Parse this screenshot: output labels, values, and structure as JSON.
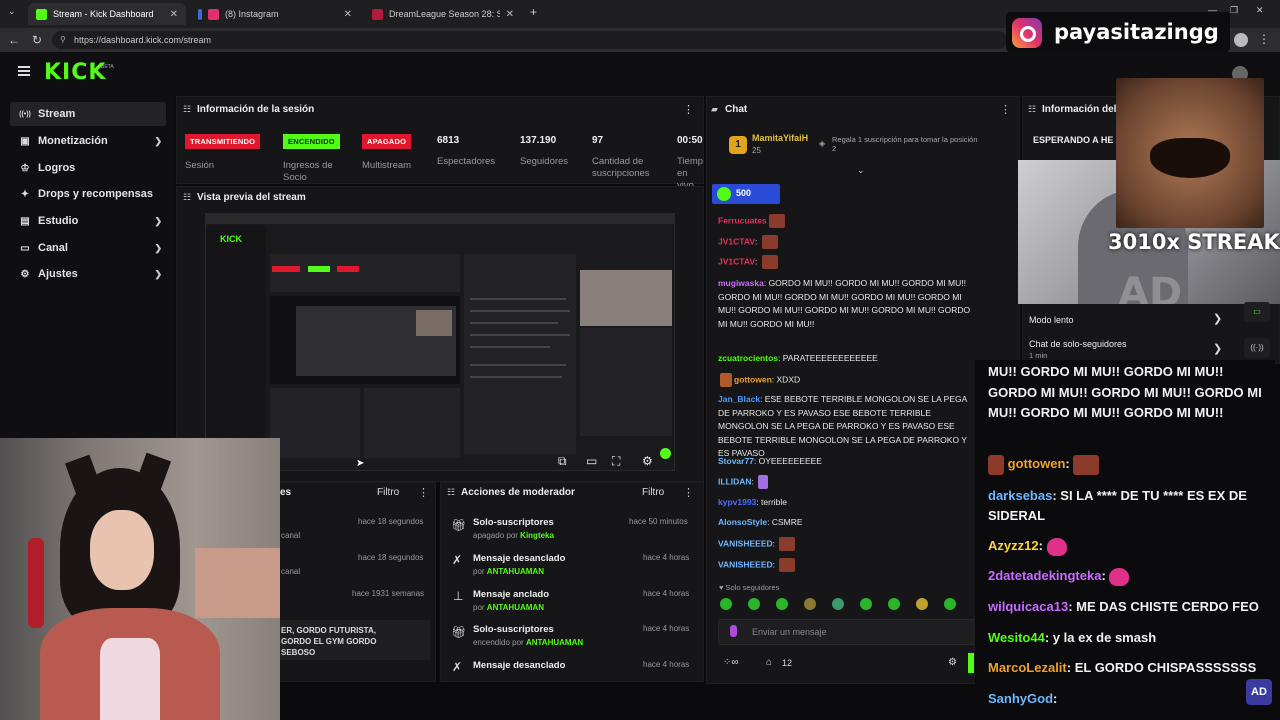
{
  "browser": {
    "tabs": [
      {
        "label": "Stream - Kick Dashboard",
        "active": true
      },
      {
        "label": "(8) Instagram",
        "active": false
      },
      {
        "label": "DreamLeague Season 28: South A",
        "active": false
      }
    ],
    "url": "https://dashboard.kick.com/stream",
    "new_tab": "+"
  },
  "instagram_overlay": {
    "handle": "payasitazingg"
  },
  "meme_overlay": {
    "text": "3010x STREAK"
  },
  "kick": {
    "logo": "KICK",
    "beta": "BETA"
  },
  "sidebar": {
    "items": [
      {
        "label": "Stream",
        "icon": "stream-icon",
        "glyph": "((•))",
        "active": true,
        "chevron": false
      },
      {
        "label": "Monetización",
        "icon": "money-icon",
        "glyph": "▣",
        "active": false,
        "chevron": true
      },
      {
        "label": "Logros",
        "icon": "trophy-icon",
        "glyph": "🏆",
        "active": false,
        "chevron": false
      },
      {
        "label": "Drops y recompensas",
        "icon": "gift-icon",
        "glyph": "✦",
        "active": false,
        "chevron": false
      },
      {
        "label": "Estudio",
        "icon": "studio-icon",
        "glyph": "▤",
        "active": false,
        "chevron": true
      },
      {
        "label": "Canal",
        "icon": "channel-icon",
        "glyph": "▭",
        "active": false,
        "chevron": true
      },
      {
        "label": "Ajustes",
        "icon": "settings-icon",
        "glyph": "⚙",
        "active": false,
        "chevron": true
      }
    ]
  },
  "session": {
    "title": "Información de la sesión",
    "badges": [
      {
        "label": "TRANSMITIENDO",
        "color": "#e0182d"
      },
      {
        "label": "ENCENDIDO",
        "color": "#53fc18"
      },
      {
        "label": "APAGADO",
        "color": "#e0182d"
      }
    ],
    "badge_labels": [
      "Sesión",
      "Ingresos de Socio",
      "Multistream"
    ],
    "stats": [
      {
        "value": "6813",
        "label": "Espectadores"
      },
      {
        "value": "137.190",
        "label": "Seguidores"
      },
      {
        "value": "97",
        "label": "Cantidad de suscripciones"
      },
      {
        "value": "00:50",
        "label": "Tiempo en vivo"
      }
    ]
  },
  "preview": {
    "title": "Vista previa del stream"
  },
  "activity": {
    "title": "es",
    "filter": "Filtro",
    "rows": [
      {
        "time": "hace 18 segundos",
        "sub": "canal"
      },
      {
        "time": "hace 18 segundos",
        "sub": "canal"
      },
      {
        "time": "hace 1931 semanas",
        "sub": "ER, GORDO FUTURISTA, GORDO EL GYM GORDO SEBOSO"
      }
    ]
  },
  "mod_actions": {
    "title": "Acciones de moderador",
    "filter": "Filtro",
    "rows": [
      {
        "title": "Solo-suscriptores",
        "sub_prefix": "apagado por",
        "sub_user": "Kingteka",
        "time": "hace 50 minutos",
        "icon": "gift-icon"
      },
      {
        "title": "Mensaje desanclado",
        "sub_prefix": "por",
        "sub_user": "ANTAHUAMAN",
        "time": "hace 4 horas",
        "icon": "unpin-icon"
      },
      {
        "title": "Mensaje anclado",
        "sub_prefix": "por",
        "sub_user": "ANTAHUAMAN",
        "time": "hace 4 horas",
        "icon": "pin-icon"
      },
      {
        "title": "Solo-suscriptores",
        "sub_prefix": "encendido por",
        "sub_user": "ANTAHUAMAN",
        "time": "hace 4 horas",
        "icon": "gift-icon"
      },
      {
        "title": "Mensaje desanclado",
        "sub_prefix": "por",
        "sub_user": "ANTAHUAMAN",
        "time": "hace 4 horas",
        "icon": "unpin-icon"
      }
    ]
  },
  "chat": {
    "title": "Chat",
    "top_gifter": {
      "name": "MamitaYifaiH",
      "count": "25",
      "prompt": "Regala 1 suscripción para tomar la posición 2"
    },
    "goal": "500",
    "lines": [
      {
        "user": "Ferrucuates",
        "color": "#e0345a",
        "text": ""
      },
      {
        "user": "JV1CTAV",
        "color": "#e0345a",
        "text": ""
      },
      {
        "user": "JV1CTAV",
        "color": "#e0345a",
        "text": ""
      },
      {
        "user": "mugiwaska",
        "color": "#c96bff",
        "text": "GORDO MI MU!! GORDO MI MU!! GORDO MI MU!! GORDO MI MU!! GORDO MI MU!! GORDO MI MU!! GORDO MI MU!! GORDO MI MU!! GORDO MI MU!! GORDO MI MU!! GORDO MI MU!! GORDO MI MU!!"
      },
      {
        "user": "zcuatrocientos",
        "color": "#53fc18",
        "text": "PARATEEEEEEEEEEEE"
      },
      {
        "user": "gottowen",
        "color": "#f0a030",
        "text": "XDXD"
      },
      {
        "user": "Jan_Black",
        "color": "#4d9bff",
        "text": "ESE BEBOTE TERRIBLE MONGOLON SE LA PEGA DE PARROKO Y ES PAVASO ESE BEBOTE TERRIBLE MONGOLON SE LA PEGA DE PARROKO Y ES PAVASO ESE BEBOTE TERRIBLE MONGOLON SE LA PEGA DE PARROKO Y ES PAVASO"
      },
      {
        "user": "Stovar77",
        "color": "#6fb7ff",
        "text": "OYEEEEEEEEE"
      },
      {
        "user": "ILLIDAN",
        "color": "#6fb7ff",
        "text": ""
      },
      {
        "user": "kypv1993",
        "color": "#4d6bff",
        "text": "terrible"
      },
      {
        "user": "AlonsoStyle",
        "color": "#6fb7ff",
        "text": "CSMRE"
      },
      {
        "user": "VANISHEEED",
        "color": "#6fb7ff",
        "text": ""
      },
      {
        "user": "VANISHEEED",
        "color": "#6fb7ff",
        "text": ""
      }
    ],
    "followers_only": "Solo seguidores",
    "input_placeholder": "Enviar un mensaje",
    "count": "12"
  },
  "stream_info": {
    "title": "Información del",
    "waiting": "ESPERANDO A HE",
    "slow_mode": "Modo lento",
    "followers_chat": "Chat de solo-seguidores",
    "followers_chat_sub": "1 min"
  },
  "overlay_chat": {
    "lines": [
      {
        "user": "",
        "color": "#fff",
        "text": "MU!! GORDO MI MU!! GORDO MI MU!! GORDO MI MU!! GORDO MI MU!! GORDO MI MU!! GORDO MI MU!! GORDO MI MU!!"
      },
      {
        "user": "gottowen",
        "color": "#f0a030",
        "text": ""
      },
      {
        "user": "darksebas",
        "color": "#6fb7ff",
        "text": "SI LA **** DE TU **** ES EX DE SIDERAL"
      },
      {
        "user": "Azyzz12",
        "color": "#ffd23f",
        "text": ""
      },
      {
        "user": "2datetadekingteka",
        "color": "#c96bff",
        "text": ""
      },
      {
        "user": "wilquicaca13",
        "color": "#c96bff",
        "text": "ME DAS CHISTE CERDO FEO"
      },
      {
        "user": "Wesito44",
        "color": "#53fc18",
        "text": "y la ex de smash"
      },
      {
        "user": "MarcoLezalit",
        "color": "#f0a030",
        "text": "EL GORDO CHISPASSSSSSS"
      },
      {
        "user": "SanhyGod",
        "color": "#6fb7ff",
        "text": ""
      }
    ]
  }
}
